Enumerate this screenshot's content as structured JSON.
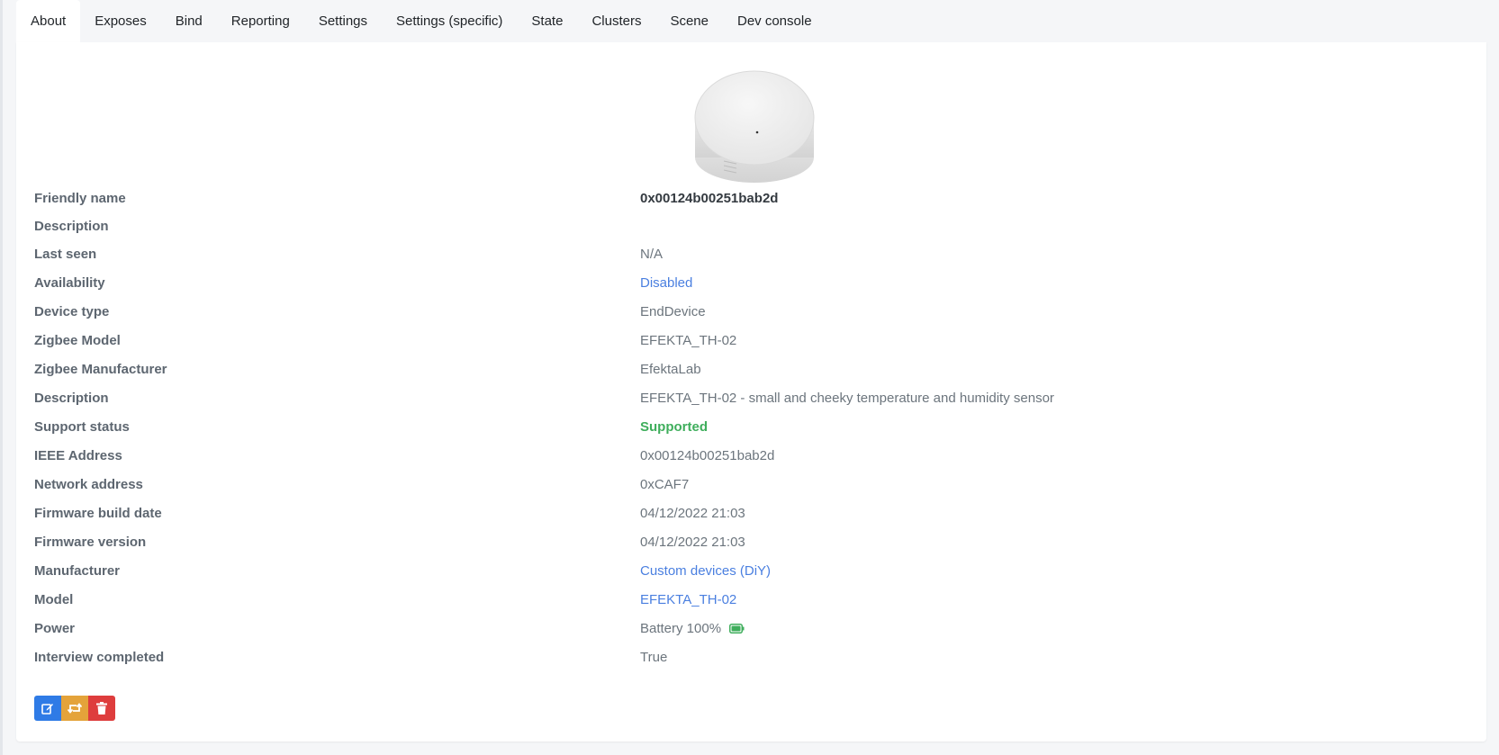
{
  "tabs": [
    {
      "label": "About",
      "active": true
    },
    {
      "label": "Exposes"
    },
    {
      "label": "Bind"
    },
    {
      "label": "Reporting"
    },
    {
      "label": "Settings"
    },
    {
      "label": "Settings (specific)"
    },
    {
      "label": "State"
    },
    {
      "label": "Clusters"
    },
    {
      "label": "Scene"
    },
    {
      "label": "Dev console"
    }
  ],
  "info": {
    "friendly_name": {
      "label": "Friendly name",
      "value": "0x00124b00251bab2d"
    },
    "description": {
      "label": "Description",
      "value": ""
    },
    "last_seen": {
      "label": "Last seen",
      "value": "N/A"
    },
    "availability": {
      "label": "Availability",
      "value": "Disabled"
    },
    "device_type": {
      "label": "Device type",
      "value": "EndDevice"
    },
    "zigbee_model": {
      "label": "Zigbee Model",
      "value": "EFEKTA_TH-02"
    },
    "zigbee_manufacturer": {
      "label": "Zigbee Manufacturer",
      "value": "EfektaLab"
    },
    "model_description": {
      "label": "Description",
      "value": "EFEKTA_TH-02 - small and cheeky temperature and humidity sensor"
    },
    "support_status": {
      "label": "Support status",
      "value": "Supported"
    },
    "ieee_address": {
      "label": "IEEE Address",
      "value": "0x00124b00251bab2d"
    },
    "network_address": {
      "label": "Network address",
      "value": "0xCAF7"
    },
    "firmware_build_date": {
      "label": "Firmware build date",
      "value": "04/12/2022 21:03"
    },
    "firmware_version": {
      "label": "Firmware version",
      "value": "04/12/2022 21:03"
    },
    "manufacturer": {
      "label": "Manufacturer",
      "value": "Custom devices (DiY)"
    },
    "model": {
      "label": "Model",
      "value": "EFEKTA_TH-02"
    },
    "power": {
      "label": "Power",
      "value": "Battery 100%",
      "battery_level": 1.0
    },
    "interview_completed": {
      "label": "Interview completed",
      "value": "True"
    }
  },
  "actions": {
    "rename_icon": "edit-icon",
    "reconfigure_icon": "retweet-icon",
    "remove_icon": "trash-icon"
  },
  "colors": {
    "link": "#4a7fe0",
    "supported": "#3fae5c",
    "edit_button": "#2f7be6",
    "reconfigure_button": "#e4a33a",
    "remove_button": "#de3d3d",
    "battery": "#3fae5c"
  }
}
